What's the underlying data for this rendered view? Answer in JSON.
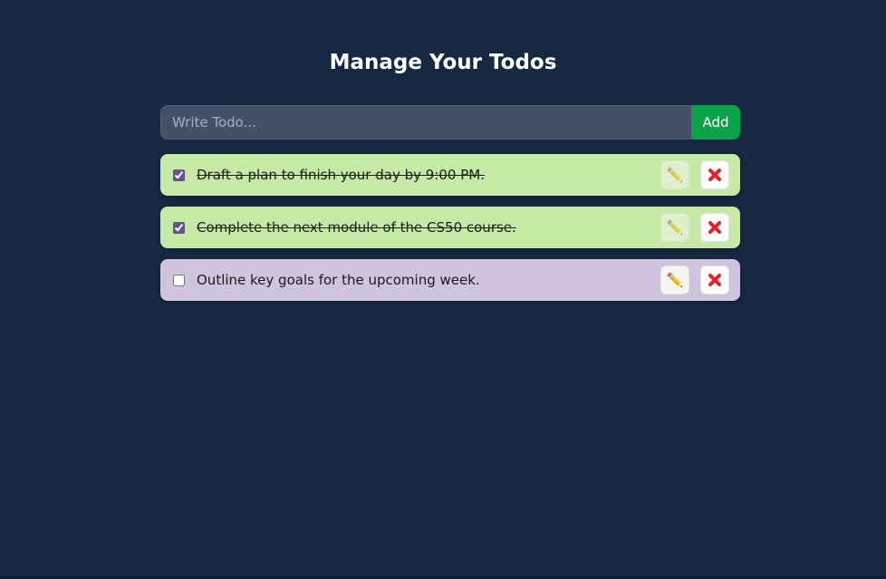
{
  "page": {
    "title": "Manage Your Todos"
  },
  "form": {
    "input_placeholder": "Write Todo...",
    "input_value": "",
    "add_label": "Add"
  },
  "todos": [
    {
      "text": "Draft a plan to finish your day by 9:00 PM.",
      "completed": true
    },
    {
      "text": "Complete the next module of the CS50 course.",
      "completed": true
    },
    {
      "text": "Outline key goals for the upcoming week.",
      "completed": false
    }
  ],
  "icons": {
    "edit": "pencil-icon",
    "delete": "cross-icon",
    "edit_glyph": "✏️"
  },
  "colors": {
    "background": "#172842",
    "input_bg": "#435066",
    "add_button": "#0aa34a",
    "completed_item": "#c6e9a6",
    "pending_item": "#cfc3de",
    "delete_icon": "#e8202a",
    "checkbox_accent": "#6b4ca0"
  }
}
